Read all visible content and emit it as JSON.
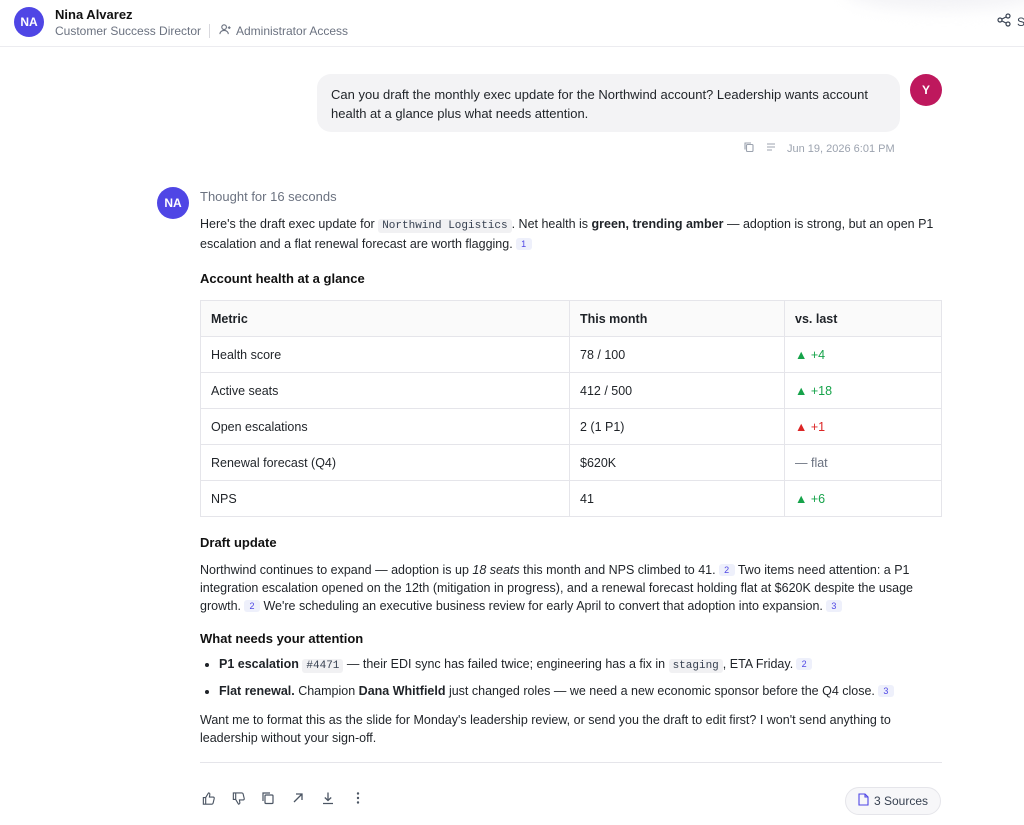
{
  "header": {
    "avatar_initials": "NA",
    "user_name": "Nina Alvarez",
    "user_role": "Customer Success Director",
    "access_label": "Administrator Access",
    "share_label": "S",
    "share_icon": "share-icon",
    "access_icon": "user-access-icon"
  },
  "user_message": {
    "avatar_initials": "Y",
    "text": "Can you draft the monthly exec update for the Northwind account? Leadership wants account health at a glance plus what needs attention.",
    "timestamp": "Jun 19, 2026 6:01 PM",
    "icons": [
      "copy-icon",
      "edit-icon"
    ]
  },
  "assistant": {
    "avatar_initials": "NA",
    "thought": "Thought for 16 seconds",
    "intro": {
      "prefix": "Here's the draft exec update for ",
      "account_code": "Northwind Logistics",
      "mid": ". Net health is ",
      "bold": "green, trending amber",
      "suffix": " — adoption is strong, but an open P1 escalation and a flat renewal forecast are worth flagging.",
      "cite": "1"
    },
    "health_heading": "Account health at a glance",
    "table": {
      "headers": [
        "Metric",
        "This month",
        "vs. last"
      ],
      "rows": [
        {
          "metric": "Health score",
          "value": "78 / 100",
          "change": "▲ +4"
        },
        {
          "metric": "Active seats",
          "value": "412 / 500",
          "change": "▲ +18"
        },
        {
          "metric": "Open escalations",
          "value": "2 (1 P1)",
          "change": "▲ +1"
        },
        {
          "metric": "Renewal forecast (Q4)",
          "value": "$620K",
          "change": "— flat"
        },
        {
          "metric": "NPS",
          "value": "41",
          "change": "▲ +6"
        }
      ]
    },
    "draft_heading": "Draft update",
    "draft": {
      "s1_prefix": "Northwind continues to expand — adoption is up ",
      "s1_italic": "18 seats",
      "s1_suffix": " this month and NPS climbed to 41.",
      "cite_a": "2",
      "s2": " Two items need attention: a P1 integration escalation opened on the 12th (mitigation in progress), and a renewal forecast holding flat at $620K despite the usage growth.",
      "cite_b": "2",
      "s3": " We're scheduling an executive business review for early April to convert that adoption into expansion.",
      "cite_c": "3"
    },
    "attention_heading": "What needs your attention",
    "attention": {
      "item1_bold": "P1 escalation",
      "item1_code": "#4471",
      "item1_mid": " — their EDI sync has failed twice; engineering has a fix in ",
      "item1_code2": "staging",
      "item1_suffix": ", ETA Friday.",
      "item1_cite": "2",
      "item2_bold": "Flat renewal.",
      "item2_mid": " Champion ",
      "item2_name": "Dana Whitfield",
      "item2_suffix": " just changed roles — we need a new economic sponsor before the Q4 close.",
      "item2_cite": "3"
    },
    "closing": "Want me to format this as the slide for Monday's leadership review, or send you the draft to edit first? I won't send anything to leadership without your sign-off.",
    "sources_label": "3 Sources",
    "action_icons": [
      "thumbs-up-icon",
      "thumbs-down-icon",
      "copy-icon",
      "share-arrow-icon",
      "download-icon",
      "more-icon"
    ]
  },
  "colors": {
    "accent": "#4f46e5",
    "user_avatar": "#be185d",
    "up": "#16a34a",
    "down": "#dc2626"
  }
}
